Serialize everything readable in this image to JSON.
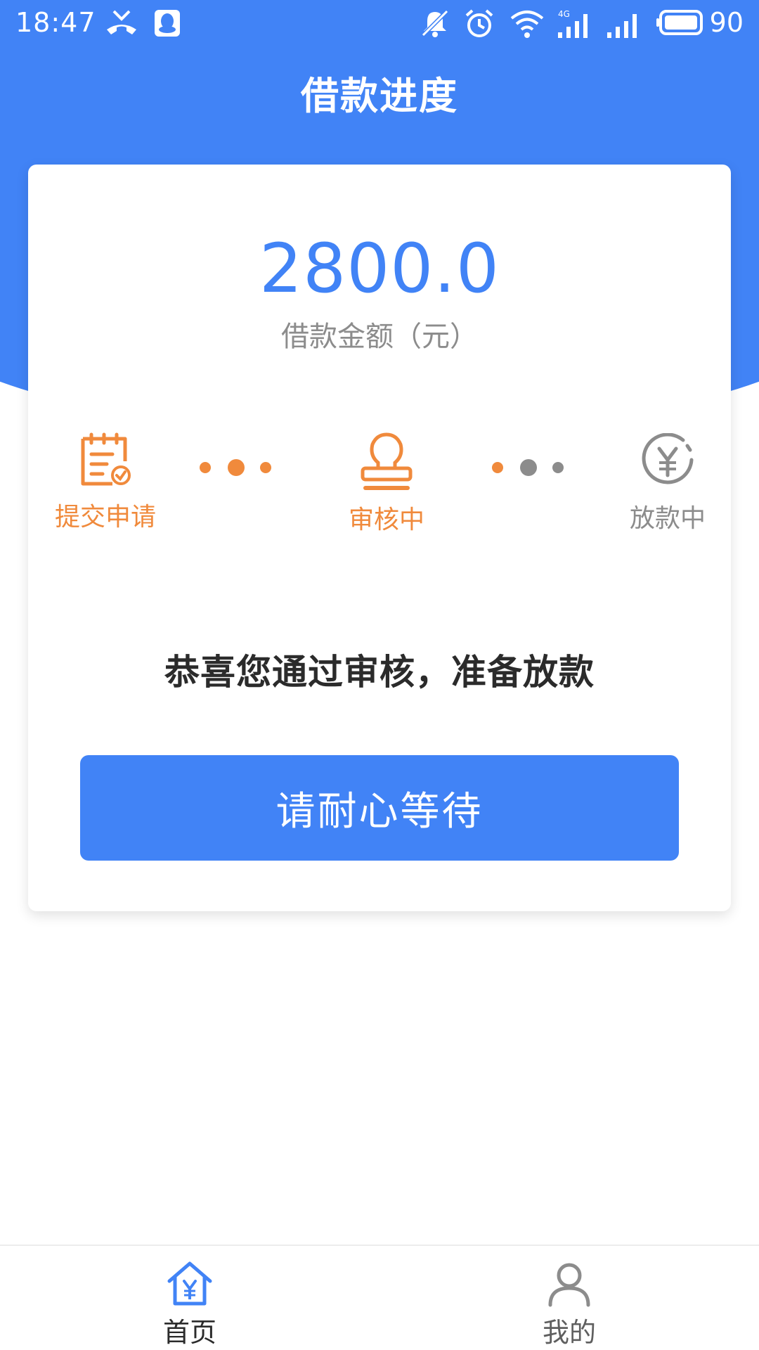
{
  "colors": {
    "primary": "#4183f6",
    "accent": "#f08a3c",
    "inactive": "#8c8c8c",
    "text_dark": "#2b2b2b"
  },
  "status_bar": {
    "time": "18:47",
    "battery": "90",
    "icons": [
      "missed-call-icon",
      "qq-icon",
      "mute-icon",
      "alarm-icon",
      "wifi-icon",
      "signal-4g-icon",
      "signal-icon",
      "battery-icon"
    ]
  },
  "header": {
    "title": "借款进度"
  },
  "loan": {
    "amount": "2800.0",
    "amount_label": "借款金额（元）"
  },
  "steps": [
    {
      "label": "提交申请",
      "icon": "clipboard-check-icon",
      "state": "done"
    },
    {
      "label": "审核中",
      "icon": "stamp-icon",
      "state": "active"
    },
    {
      "label": "放款中",
      "icon": "yuan-circle-icon",
      "state": "pending"
    }
  ],
  "message": "恭喜您通过审核，准备放款",
  "button": {
    "label": "请耐心等待"
  },
  "tabs": [
    {
      "label": "首页",
      "icon": "home-yuan-icon",
      "active": true
    },
    {
      "label": "我的",
      "icon": "user-icon",
      "active": false
    }
  ]
}
